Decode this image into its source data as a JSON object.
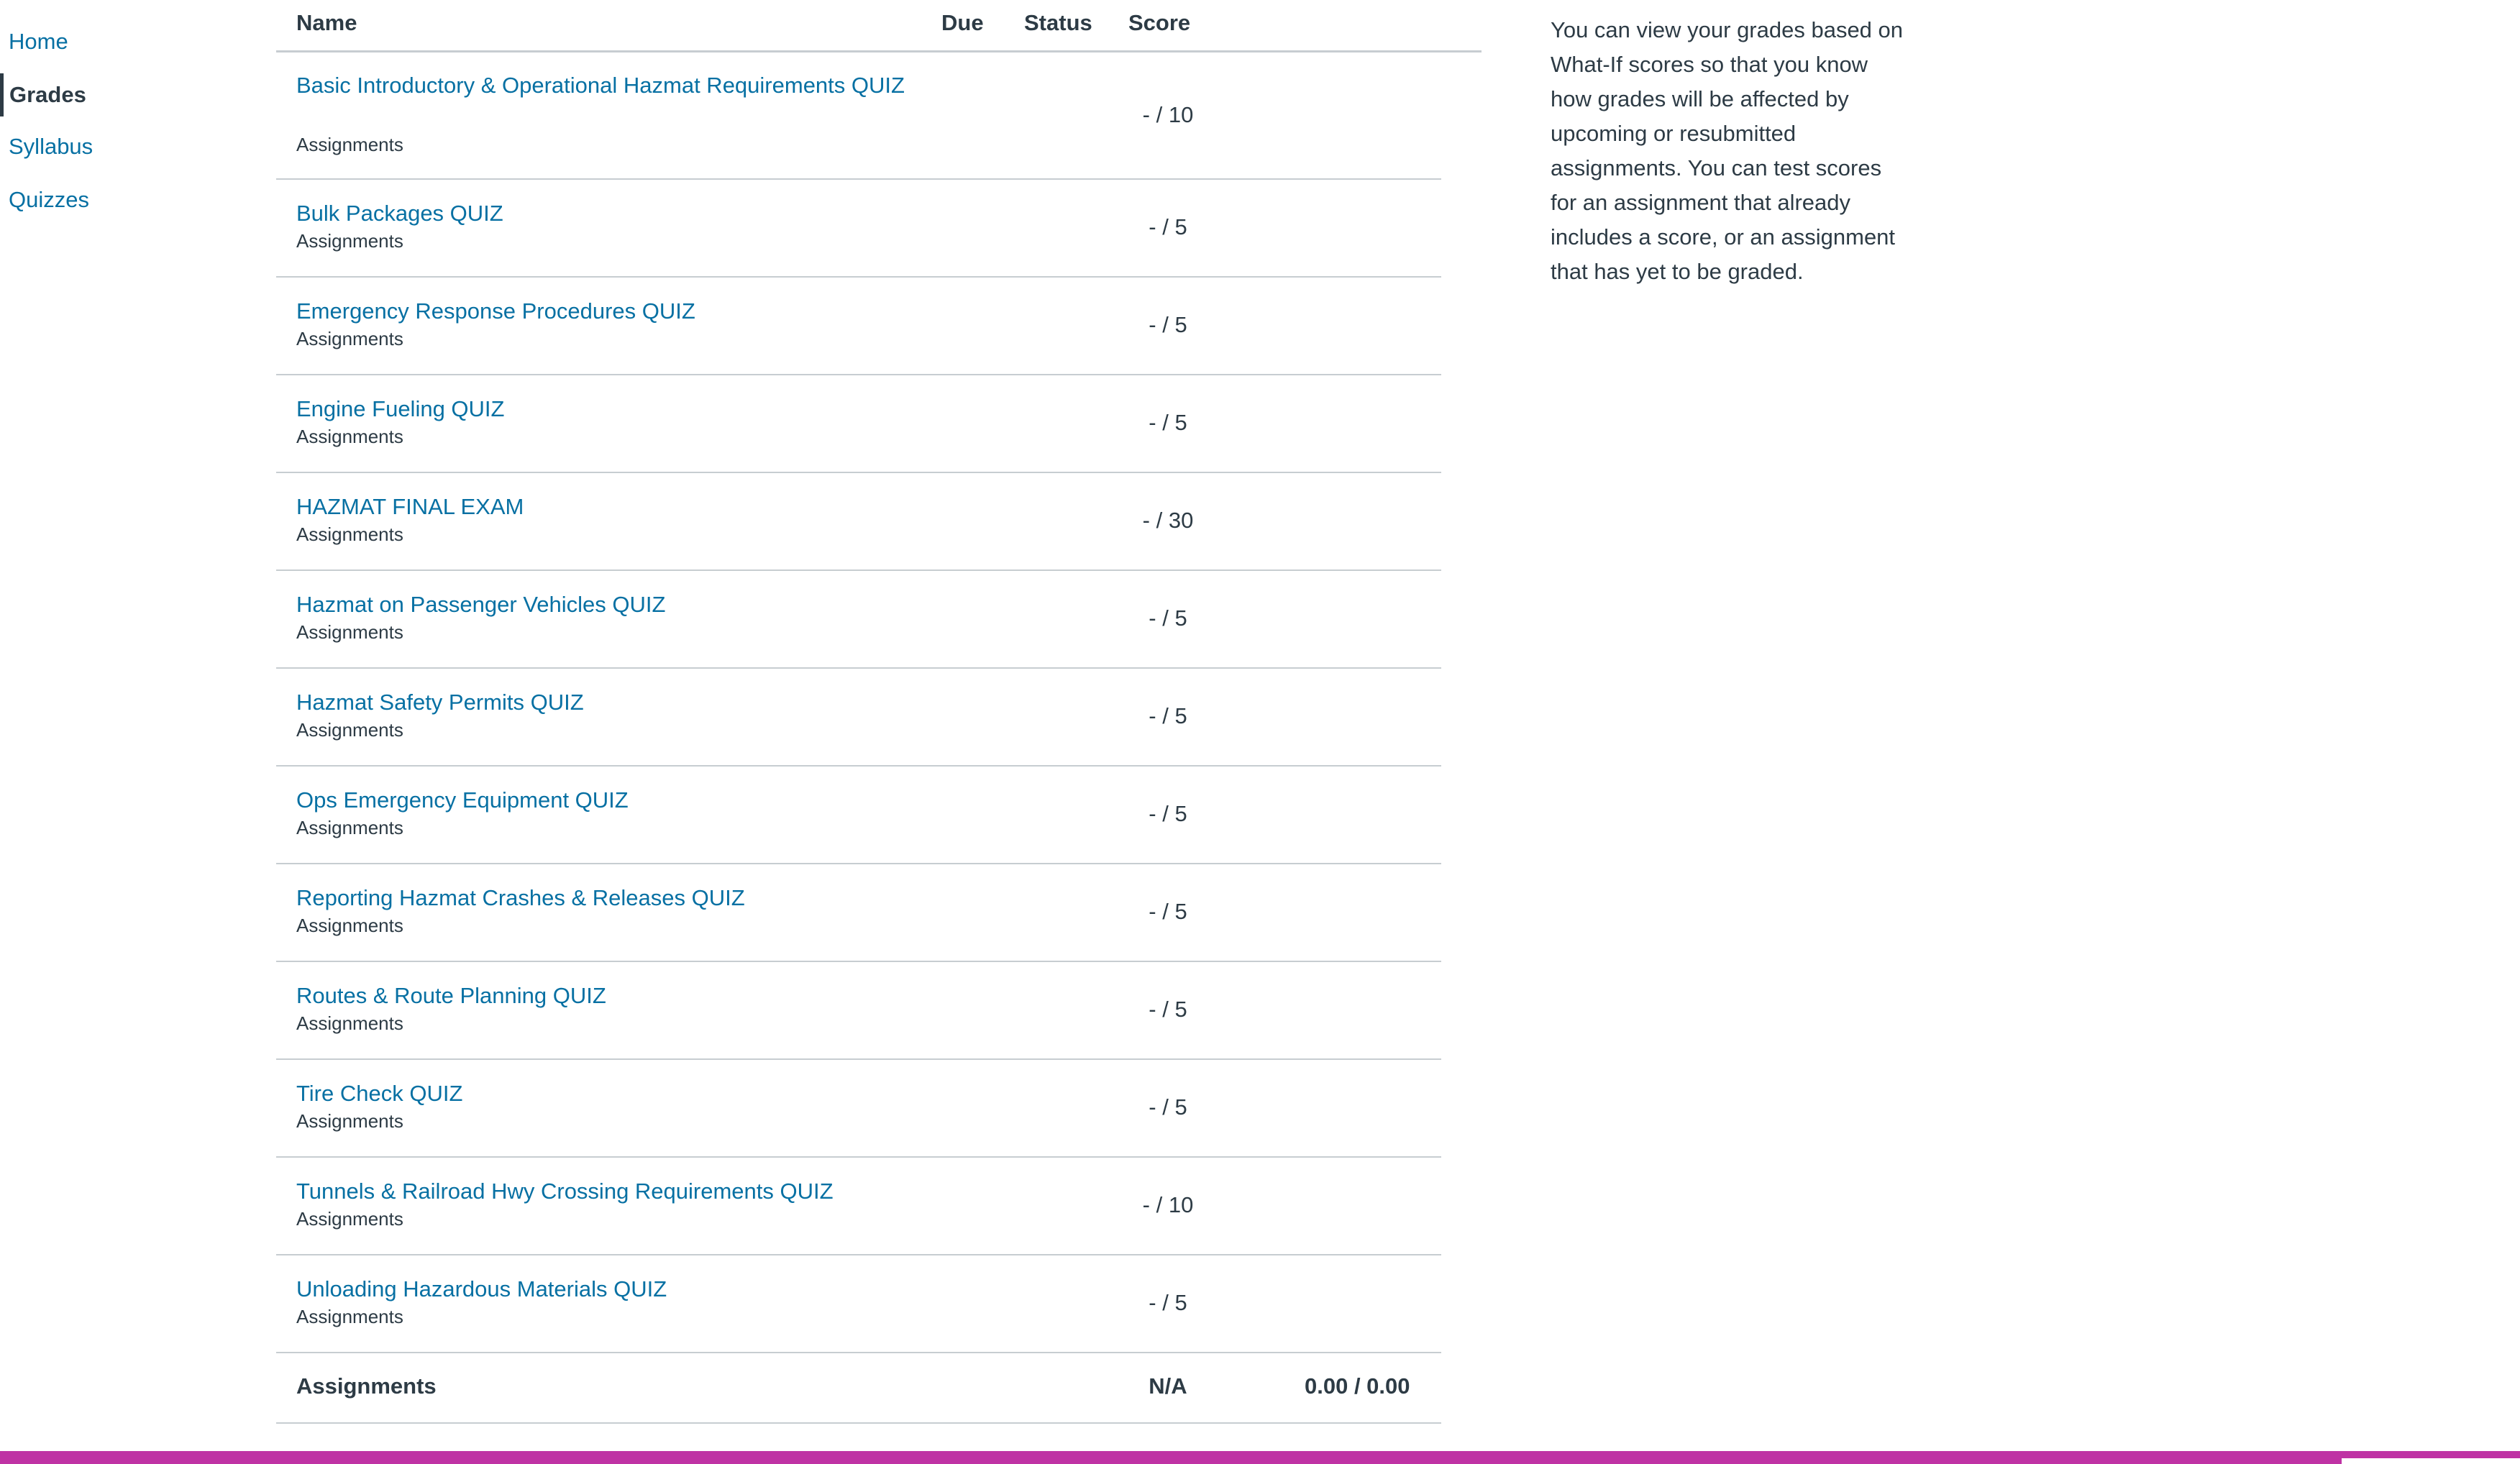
{
  "nav": {
    "items": [
      {
        "label": "Home",
        "active": false
      },
      {
        "label": "Grades",
        "active": true
      },
      {
        "label": "Syllabus",
        "active": false
      },
      {
        "label": "Quizzes",
        "active": false
      }
    ]
  },
  "table": {
    "headers": {
      "name": "Name",
      "due": "Due",
      "status": "Status",
      "score": "Score"
    },
    "rows": [
      {
        "name": "Basic Introductory & Operational Hazmat Requirements QUIZ",
        "group": "Assignments",
        "score": "- / 10"
      },
      {
        "name": "Bulk Packages QUIZ",
        "group": "Assignments",
        "score": "- / 5"
      },
      {
        "name": "Emergency Response Procedures QUIZ",
        "group": "Assignments",
        "score": "- / 5"
      },
      {
        "name": "Engine Fueling QUIZ",
        "group": "Assignments",
        "score": "- / 5"
      },
      {
        "name": "HAZMAT FINAL EXAM",
        "group": "Assignments",
        "score": "- / 30"
      },
      {
        "name": "Hazmat on Passenger Vehicles QUIZ",
        "group": "Assignments",
        "score": "- / 5"
      },
      {
        "name": "Hazmat Safety Permits QUIZ",
        "group": "Assignments",
        "score": "- / 5"
      },
      {
        "name": "Ops Emergency Equipment QUIZ",
        "group": "Assignments",
        "score": "- / 5"
      },
      {
        "name": "Reporting Hazmat Crashes & Releases QUIZ",
        "group": "Assignments",
        "score": "- / 5"
      },
      {
        "name": "Routes & Route Planning QUIZ",
        "group": "Assignments",
        "score": "- / 5"
      },
      {
        "name": "Tire Check QUIZ",
        "group": "Assignments",
        "score": "- / 5"
      },
      {
        "name": "Tunnels & Railroad Hwy Crossing Requirements QUIZ",
        "group": "Assignments",
        "score": "- / 10"
      },
      {
        "name": "Unloading Hazardous Materials QUIZ",
        "group": "Assignments",
        "score": "- / 5"
      }
    ],
    "total": {
      "label": "Assignments",
      "score": "N/A",
      "points": "0.00 / 0.00"
    }
  },
  "sidenote": {
    "text": "You can view your grades based on What-If scores so that you know how grades will be affected by upcoming or resubmitted assignments. You can test scores for an assignment that already includes a score, or an assignment that has yet to be graded."
  },
  "colors": {
    "link": "#0770a3",
    "text": "#2d3b45",
    "divider": "#c7cdd1",
    "brand": "#bf32a4"
  }
}
